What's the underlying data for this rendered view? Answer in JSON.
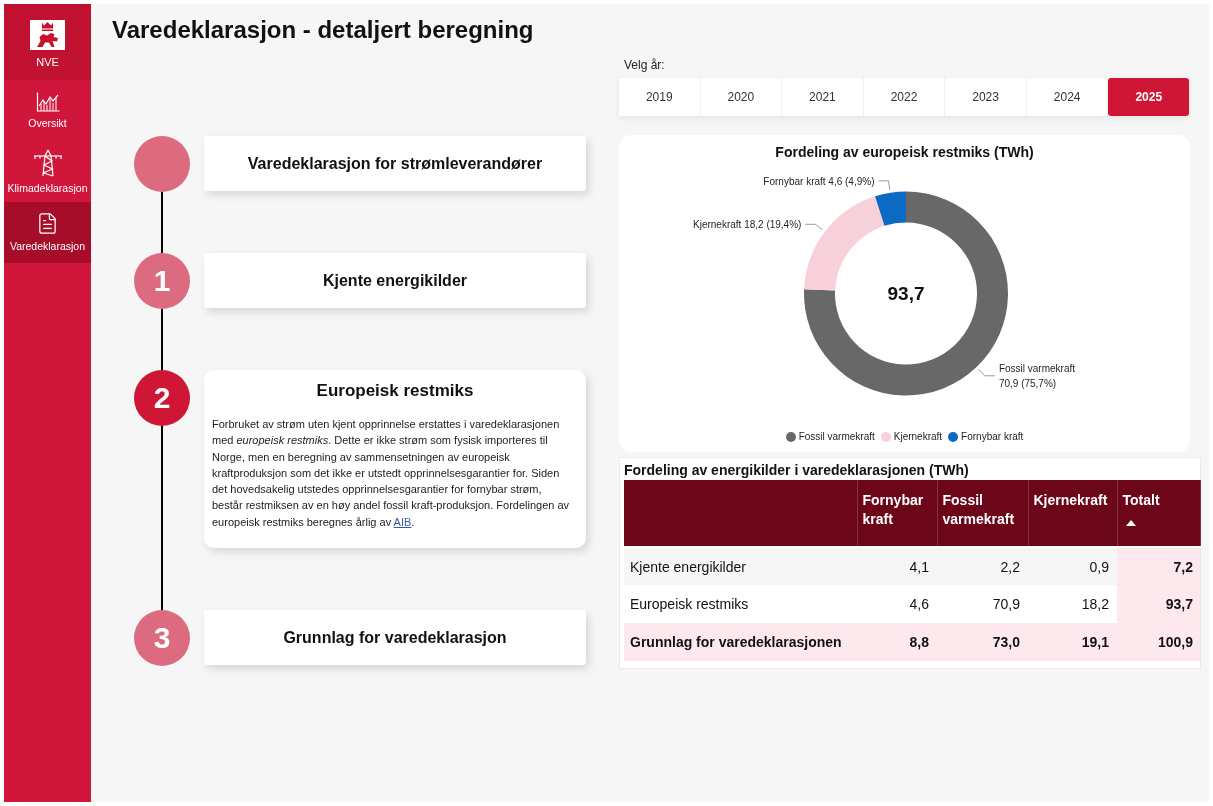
{
  "sidebar": {
    "logo_label": "NVE",
    "items": [
      {
        "label": "Oversikt",
        "selected": false
      },
      {
        "label": "Klimadeklarasjon",
        "selected": false
      },
      {
        "label": "Varedeklarasjon",
        "selected": true
      }
    ]
  },
  "page_title": "Varedeklarasjon - detaljert beregning",
  "steps": [
    {
      "title": "Varedeklarasjon for strømleverandører",
      "selected": false
    },
    {
      "number": "1",
      "title": "Kjente energikilder",
      "selected": false
    },
    {
      "number": "2",
      "title": "Europeisk restmiks",
      "selected": true,
      "description": "Forbruket av strøm uten kjent opprinnelse erstattes i varedeklarasjonen med *europeisk restmiks*. Dette er ikke strøm som fysisk importeres til Norge, men en beregning av sammensetningen av europeisk kraftproduksjon som det ikke er utstedt opprinnelsesgarantier for. Siden det hovedsakelig utstedes opprinnelsesgarantier for fornybar strøm, består restmiksen av en høy andel fossil kraft-produksjon. Fordelingen av europeisk restmiks beregnes årlig av",
      "link": "AIB",
      "description_end": "."
    },
    {
      "number": "3",
      "title": "Grunnlag for varedeklarasjon",
      "selected": false
    }
  ],
  "year_picker": {
    "label": "Velg år:",
    "years": [
      {
        "label": "2019",
        "selected": false
      },
      {
        "label": "2020",
        "selected": false
      },
      {
        "label": "2021",
        "selected": false
      },
      {
        "label": "2022",
        "selected": false
      },
      {
        "label": "2023",
        "selected": false
      },
      {
        "label": "2024",
        "selected": false
      },
      {
        "label": "2025",
        "selected": true
      }
    ]
  },
  "restmix_chart": {
    "center_value": "93,7",
    "chart_data": {
      "type": "donut",
      "title": "Fordeling av europeisk restmiks (TWh)",
      "categories": [
        "Fossil varmekraft",
        "Kjernekraft",
        "Fornybar kraft"
      ],
      "values": [
        70.9,
        18.2,
        4.6
      ],
      "colors": [
        "#686868",
        "#f8d0da",
        "#0b6ac4"
      ],
      "value_labels": [
        "Fossil varmekraft 70,9 (75,7%)",
        "Kjernekraft 18,2 (19,4%)",
        "Fornybar kraft 4,6 (4,9%)"
      ]
    }
  },
  "table": {
    "title": "Fordeling av energikilder i varedeklarasjonen (TWh)",
    "columns": [
      {
        "label": "Fornybar kraft",
        "sorted": false
      },
      {
        "label": "Fossil varmekraft",
        "sorted": false
      },
      {
        "label": "Kjernekraft",
        "sorted": false
      },
      {
        "label": "Totalt",
        "sorted": true
      }
    ],
    "rows": [
      {
        "kind": "source",
        "label": "Kjente energikilder",
        "cells": [
          "4,1",
          "2,2",
          "0,9",
          "7,2"
        ]
      },
      {
        "kind": "source",
        "label": "Europeisk restmiks",
        "cells": [
          "4,6",
          "70,9",
          "18,2",
          "93,7"
        ]
      },
      {
        "kind": "total",
        "label": "Grunnlag for varedeklarasjonen",
        "cells": [
          "8,8",
          "73,0",
          "19,1",
          "100,9"
        ]
      }
    ]
  }
}
